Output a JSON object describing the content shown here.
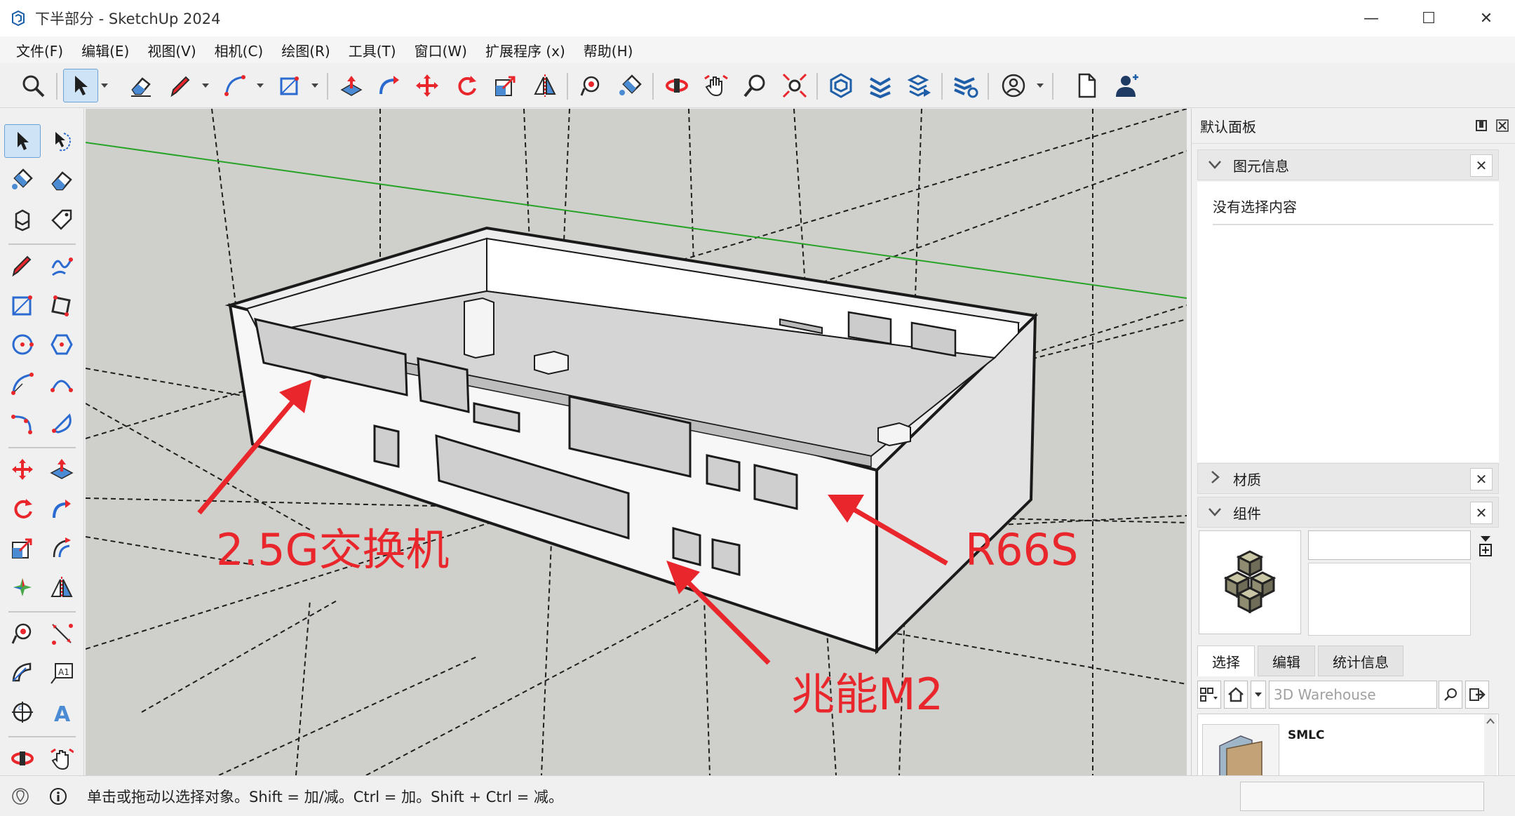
{
  "window": {
    "title": "下半部分 - SketchUp 2024",
    "controls": {
      "minimize": "—",
      "maximize": "☐",
      "close": "✕"
    }
  },
  "menu": [
    "文件(F)",
    "编辑(E)",
    "视图(V)",
    "相机(C)",
    "绘图(R)",
    "工具(T)",
    "窗口(W)",
    "扩展程序 (x)",
    "帮助(H)"
  ],
  "toolbar_icons": [
    "search-icon",
    "select-icon",
    "eraser-icon",
    "pencil-icon",
    "arc-icon",
    "rectangle-icon",
    "push-pull-icon",
    "follow-me-icon",
    "move-icon",
    "rotate-icon",
    "scale-icon",
    "flip-icon",
    "tape-icon",
    "paint-icon",
    "orbit-icon",
    "pan-icon",
    "zoom-icon",
    "zoom-extents-icon",
    "warehouse-icon",
    "extension-warehouse-icon",
    "layout-icon",
    "extension-manager-icon",
    "account-icon",
    "new-file-icon",
    "profile-icon"
  ],
  "annotations": {
    "switch": "2.5G交换机",
    "r66s": "R66S",
    "m2": "兆能M2"
  },
  "colors": {
    "annotation": "#e8262b",
    "selection": "#cfe3f7",
    "green_axis": "#27a327"
  },
  "panel": {
    "title": "默认面板",
    "entity_info": {
      "title": "图元信息",
      "message": "没有选择内容"
    },
    "materials": {
      "title": "材质"
    },
    "components": {
      "title": "组件",
      "tabs": [
        "选择",
        "编辑",
        "统计信息"
      ],
      "search_placeholder": "3D Warehouse",
      "list_item": "SMLC"
    }
  },
  "status": {
    "hint": "单击或拖动以选择对象。Shift = 加/减。Ctrl = 加。Shift + Ctrl = 减。"
  }
}
